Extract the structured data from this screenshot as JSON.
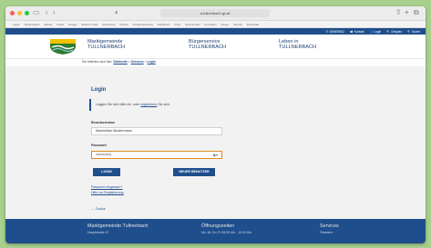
{
  "browser": {
    "url": "a.tullnerbach.gv.at",
    "bookmarks": [
      "Apple",
      "Wissenswert",
      "Aktuell",
      "Cloud",
      "Google",
      "Weitere Links",
      "Sammlung",
      "Photos",
      "Kinderbetreuung",
      "Nützliches",
      "Preis",
      "Gewinnspiel",
      "Anmelden",
      "Neues",
      "Service",
      "Download"
    ]
  },
  "topbar": {
    "items": [
      "☰ GEMEIND2",
      "☎ Kontakt",
      "👤 Login",
      "🔍 Ortsplan",
      "🔍 Suche"
    ]
  },
  "header": {
    "nav": [
      {
        "line1": "Marktgemeinde",
        "line2": "TULLNERBACH"
      },
      {
        "line1": "Bürgerservice",
        "line2": "TULLNERBACH"
      },
      {
        "line1": "Leben in",
        "line2": "TULLNERBACH"
      }
    ]
  },
  "breadcrumb": {
    "prefix": "Sie befinden sich hier:",
    "items": [
      "Startseite",
      "Services",
      "Login"
    ],
    "sep": ">"
  },
  "login": {
    "title": "Login",
    "notice_prefix": "Loggen Sie sich bitte ein, oder",
    "notice_link": "registrieren",
    "notice_suffix": "Sie sich.",
    "username_label": "Benutzername",
    "username_value": "Maximilian Mustermann",
    "password_label": "Passwort",
    "password_value": "••••••••••••|",
    "login_button": "LOGIN",
    "new_user_button": "NEUER BENUTZER",
    "forgot_link": "Passwort vergessen?",
    "help_link": "Hilfe zur Registrierung",
    "back": "← Zurück"
  },
  "footer": {
    "col1": {
      "title": "Marktgemeinde Tullnerbach",
      "sub": "Hauptstraße 47"
    },
    "col2": {
      "title": "Öffnungszeiten",
      "sub": "Mo, Mi, Do, Fr     08:00 Uhr - 12:00 Uhr"
    },
    "col3": {
      "title": "Services",
      "sub": "Finanzen"
    }
  },
  "colors": {
    "brand_blue": "#1f4e8c",
    "page_bg": "#a8d08d",
    "focus_orange": "#e08b1e"
  }
}
